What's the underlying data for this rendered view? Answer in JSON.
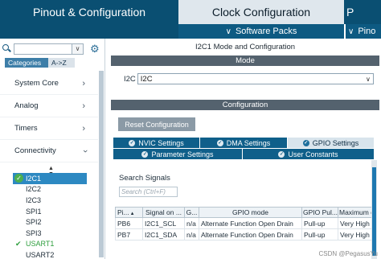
{
  "top_tabs": {
    "pinout": "Pinout & Configuration",
    "clock": "Clock Configuration",
    "third": "P"
  },
  "sub_bar": {
    "software_packs": "Software Packs",
    "right_cut": "Pino"
  },
  "left": {
    "search_value": "",
    "segments": {
      "categories": "Categories",
      "az": "A->Z"
    },
    "categories": [
      {
        "label": "System Core"
      },
      {
        "label": "Analog"
      },
      {
        "label": "Timers"
      },
      {
        "label": "Connectivity"
      }
    ],
    "peripherals": [
      {
        "label": "I2C1",
        "state": "selected-checked"
      },
      {
        "label": "I2C2",
        "state": "normal"
      },
      {
        "label": "I2C3",
        "state": "normal"
      },
      {
        "label": "SPI1",
        "state": "normal"
      },
      {
        "label": "SPI2",
        "state": "normal"
      },
      {
        "label": "SPI3",
        "state": "normal"
      },
      {
        "label": "USART1",
        "state": "checked"
      },
      {
        "label": "USART2",
        "state": "normal"
      }
    ]
  },
  "right": {
    "panel_title": "I2C1 Mode and Configuration",
    "mode_header": "Mode",
    "i2c_label": "I2C",
    "i2c_value": "I2C",
    "configuration_header": "Configuration",
    "reset_button": "Reset Configuration",
    "tabs": {
      "nvic": "NVIC Settings",
      "dma": "DMA Settings",
      "gpio": "GPIO Settings",
      "param": "Parameter Settings",
      "user": "User Constants"
    },
    "search_signals_label": "Search Signals",
    "search_signals_placeholder": "Search (Ctrl+F)",
    "table": {
      "headers": [
        "Pi...",
        "Signal on ...",
        "G...",
        "GPIO mode",
        "GPIO Pul...",
        "Maximum o..."
      ],
      "rows": [
        [
          "PB6",
          "I2C1_SCL",
          "n/a",
          "Alternate Function Open Drain",
          "Pull-up",
          "Very High"
        ],
        [
          "PB7",
          "I2C1_SDA",
          "n/a",
          "Alternate Function Open Drain",
          "Pull-up",
          "Very High"
        ]
      ]
    }
  },
  "watermark": "CSDN @PegasusYu",
  "colors": {
    "brand_dark": "#0a4f72",
    "tab_active": "#d8e4ec",
    "section_bar": "#54626e",
    "selection": "#2d89c2",
    "check_green": "#2e9e3d"
  }
}
